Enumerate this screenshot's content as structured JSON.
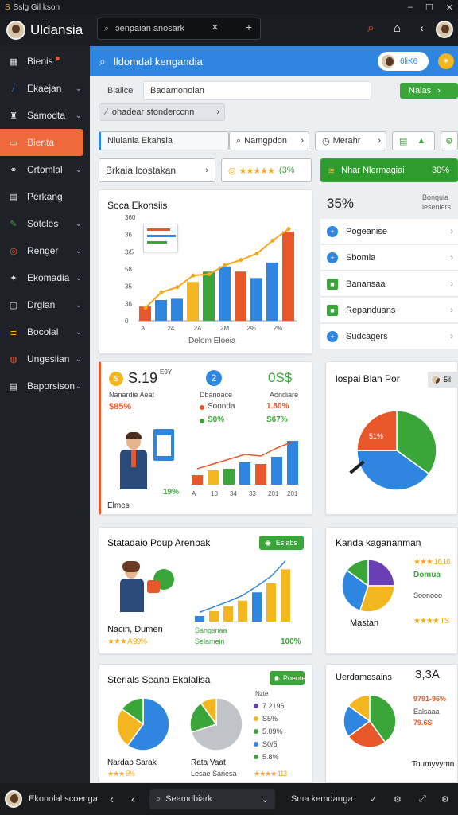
{
  "titlebar": {
    "title": "Sslg Gil kson",
    "controls": [
      "–",
      "☐",
      "✕"
    ]
  },
  "appbar": {
    "app_name": "Uldansia",
    "search_value": "ɔenpaian anosark",
    "icons": [
      "search-icon",
      "home-icon",
      "back-icon",
      "avatar"
    ]
  },
  "sidebar": {
    "items": [
      {
        "label": "Bienis",
        "icon": "grid-icon",
        "chevron": false,
        "dot": true
      },
      {
        "label": "Ekaejan",
        "icon": "slash-icon",
        "chevron": true
      },
      {
        "label": "Samodta",
        "icon": "tower-icon",
        "chevron": true
      },
      {
        "label": "Bienta",
        "icon": "square-icon",
        "chevron": false,
        "active": true
      },
      {
        "label": "Crtomlal",
        "icon": "network-icon",
        "chevron": true
      },
      {
        "label": "Perkang",
        "icon": "table-icon",
        "chevron": false
      },
      {
        "label": "Sotcles",
        "icon": "pen-icon",
        "chevron": true
      },
      {
        "label": "Renger",
        "icon": "swirl-icon",
        "chevron": true
      },
      {
        "label": "Ekomadia",
        "icon": "shape-icon",
        "chevron": true
      },
      {
        "label": "Drglan",
        "icon": "frame-icon",
        "chevron": true
      },
      {
        "label": "Bocolal",
        "icon": "layers-icon",
        "chevron": true
      },
      {
        "label": "Ungesiian",
        "icon": "globe-icon",
        "chevron": true
      },
      {
        "label": "Baporsison",
        "icon": "doc-icon",
        "chevron": true
      }
    ]
  },
  "header": {
    "title": "lldomdal kengandia",
    "badge": "6liK6"
  },
  "filters": {
    "field_label": "Blaiice",
    "field_value": "Badamonolan",
    "primary_btn": "Nalas",
    "breadcrumb": "ohadear stonderccnn",
    "tab1": "Nlulanla Ekahsia",
    "tab2": "Namgpdon",
    "tab3": "Merahr",
    "bar1": "Brkaia lcostakan",
    "bar2_value": "(3%",
    "bar3_label": "Nhar Nlermagiai",
    "bar3_value": "30%"
  },
  "chart_card": {
    "title": "Soca Ekonsiis",
    "xlabel": "Delom Eloeia"
  },
  "chart_data": {
    "type": "bar",
    "categories": [
      "A",
      "24",
      "2A",
      "2M",
      "2%",
      "2%"
    ],
    "series": [
      {
        "values": [
          55,
          80,
          85,
          150,
          190,
          210,
          190,
          165,
          225,
          345
        ]
      }
    ],
    "bar_colors": [
      "#e8572a",
      "#2f86e0",
      "#2f86e0",
      "#f3b61f",
      "#3aa639",
      "#2f86e0",
      "#e8572a",
      "#2f86e0",
      "#2f86e0",
      "#e8572a"
    ],
    "line": [
      50,
      110,
      130,
      175,
      180,
      215,
      235,
      260,
      310,
      355
    ],
    "yticks": [
      "0",
      "36",
      "35",
      "58",
      "3/5",
      "36",
      "360"
    ],
    "ylim": [
      0,
      400
    ]
  },
  "right_panel": {
    "big_value": "35%",
    "aside": "Bongula lesenlers",
    "list": [
      {
        "label": "Pogeanise",
        "color": "#2f86e0"
      },
      {
        "label": "Sbomia",
        "color": "#2f86e0"
      },
      {
        "label": "Banansaa",
        "color": "#3aa639"
      },
      {
        "label": "Repanduans",
        "color": "#3aa639"
      },
      {
        "label": "Sudcagers",
        "color": "#2f86e0"
      }
    ]
  },
  "stats_card": {
    "amount": "S.19",
    "amount_suffix": "E0Y",
    "amount_label": "Nanardie Aeat",
    "amount_pct": "$85%",
    "circle_num": "2",
    "mid_label": "Dbanoace",
    "mid_item1": "Soonda",
    "mid_item2": "S0%",
    "right_big": "0S$",
    "right_label": "Aondiare",
    "right_pct1": "1.80%",
    "right_pct2": "S67%",
    "person_pct": "19%",
    "foot_label": "Elmes",
    "mini_ticks": [
      "A",
      "10",
      "34",
      "33",
      "201",
      "201"
    ]
  },
  "mini_bar": {
    "values": [
      12,
      18,
      20,
      28,
      26,
      35,
      55
    ],
    "line": [
      14,
      20,
      26,
      32,
      30,
      40,
      48
    ]
  },
  "pie_card": {
    "title": "lospai Blan Por",
    "tag": "5il",
    "slice_label": "51%"
  },
  "pie1": [
    {
      "v": 35,
      "c": "#3aa639"
    },
    {
      "v": 40,
      "c": "#2f86e0"
    },
    {
      "v": 25,
      "c": "#e8572a"
    }
  ],
  "poup_card": {
    "title": "Statadaio Poup Arenbak",
    "button": "Eslabs",
    "name": "Nacin, Dumen",
    "rating": "★★★ A 99%",
    "legend1": "Sangsnaa",
    "legend2": "Selamein",
    "pct": "100%"
  },
  "line_card": {
    "values": [
      8,
      15,
      22,
      30,
      42,
      55,
      75
    ]
  },
  "karda_card": {
    "title": "Kanda kagananman",
    "name": "Mastan",
    "r1": "★★★ 16,16",
    "r2": "Domua",
    "r3": "Soonooo",
    "r4": "★★★★ TS"
  },
  "pie2": [
    {
      "v": 25,
      "c": "#6a3fb5"
    },
    {
      "v": 30,
      "c": "#f3b61f"
    },
    {
      "v": 30,
      "c": "#2f86e0"
    },
    {
      "v": 15,
      "c": "#3aa639"
    }
  ],
  "stenals_card": {
    "title": "Sterials Seana Ekalalisa",
    "button": "Poeote",
    "label1": "Nardap Sarak",
    "label2": "Rata Vaat",
    "footer1": "★★★ 5%",
    "footer2": "Lesae Sariesa",
    "legend_top": "Nzte",
    "legend": [
      "7.2196",
      "S5%",
      "5.09%",
      "S0/5",
      "5.8%"
    ],
    "legend_stars": "★★★★ 113"
  },
  "pie3": [
    {
      "v": 60,
      "c": "#2f86e0"
    },
    {
      "v": 25,
      "c": "#f3b61f"
    },
    {
      "v": 15,
      "c": "#3aa639"
    }
  ],
  "pie4": [
    {
      "v": 70,
      "c": "#c0c4c9"
    },
    {
      "v": 20,
      "c": "#3aa639"
    },
    {
      "v": 10,
      "c": "#f3b61f"
    }
  ],
  "uerd_card": {
    "title": "Uerdamesains",
    "big": "3,3A",
    "item1": "9791-96%",
    "item2": "Ealsaaa",
    "item3": "79.6S",
    "footer": "Toumyvymn"
  },
  "pie5": [
    {
      "v": 40,
      "c": "#3aa639"
    },
    {
      "v": 25,
      "c": "#e8572a"
    },
    {
      "v": 20,
      "c": "#2f86e0"
    },
    {
      "v": 15,
      "c": "#f3b61f"
    }
  ],
  "bottom": {
    "label": "Ekonolal scoenga",
    "search": "Seamdbiark",
    "label2": "Snıa kemdarıga"
  }
}
